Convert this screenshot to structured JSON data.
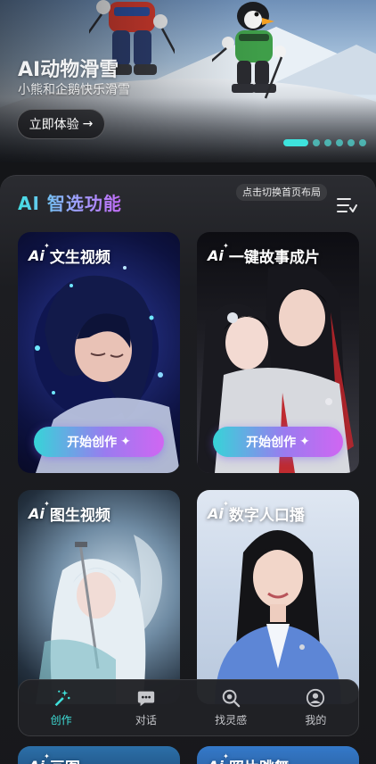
{
  "hero": {
    "title": "AI动物滑雪",
    "subtitle": "小熊和企鹅快乐滑雪",
    "cta_label": "立即体验",
    "cta_arrow": "→",
    "carousel_pages": 6,
    "carousel_active_index": 0
  },
  "features": {
    "title": "AI 智选功能",
    "layout_toggle_label": "点击切换首页布局",
    "cards": [
      {
        "label": "文生视频",
        "button": "开始创作"
      },
      {
        "label": "一键故事成片",
        "button": "开始创作"
      },
      {
        "label": "图生视频"
      },
      {
        "label": "数字人口播"
      },
      {
        "label": "画图"
      },
      {
        "label": "照片跳舞"
      }
    ],
    "ai_badge": "Ai",
    "sparkle": "✦"
  },
  "tabbar": {
    "tabs": [
      {
        "label": "创作",
        "icon": "magic-wand-icon",
        "active": true
      },
      {
        "label": "对话",
        "icon": "chat-bubble-icon",
        "active": false
      },
      {
        "label": "找灵感",
        "icon": "search-icon",
        "active": false
      },
      {
        "label": "我的",
        "icon": "profile-icon",
        "active": false
      }
    ]
  },
  "colors": {
    "accent": "#3ee3dd",
    "gradient_start": "#36d4d8",
    "gradient_end": "#d066f2",
    "background": "#141518"
  }
}
